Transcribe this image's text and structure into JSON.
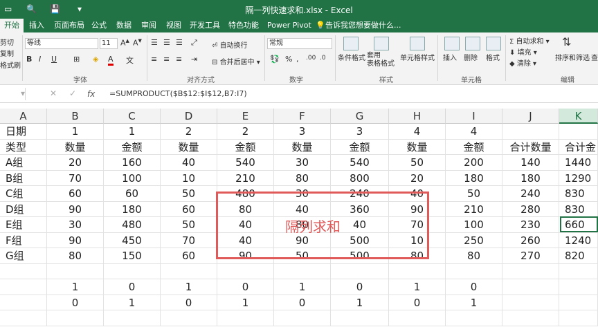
{
  "window": {
    "title": "隔一列快速求和.xlsx - Excel",
    "quick_access": [
      "save-icon",
      "undo-icon",
      "customize-icon"
    ]
  },
  "tabs": [
    "开始",
    "插入",
    "页面布局",
    "公式",
    "数据",
    "审阅",
    "视图",
    "开发工具",
    "特色功能",
    "Power Pivot"
  ],
  "tell_me": "告诉我您想要做什么...",
  "ribbon": {
    "clipboard": {
      "cut": "剪切",
      "copy": "复制",
      "format_painter": "格式刷"
    },
    "font": {
      "name": "等线",
      "size": "11",
      "bold": "B",
      "italic": "I",
      "underline": "U",
      "group": "字体"
    },
    "alignment": {
      "wrap": "自动换行",
      "merge": "合并后居中",
      "group": "对齐方式"
    },
    "number": {
      "format": "常规",
      "group": "数字"
    },
    "styles": {
      "conditional": "条件格式",
      "table": "套用\n表格格式",
      "cell": "单元格样式",
      "group": "样式"
    },
    "cells": {
      "insert": "插入",
      "delete": "删除",
      "format": "格式",
      "group": "单元格"
    },
    "editing": {
      "autosum": "自动求和",
      "fill": "填充",
      "clear": "清除",
      "sort": "排序和筛选",
      "find": "查",
      "group": "编辑"
    }
  },
  "formula_bar": {
    "fx": "fx",
    "formula": "=SUMPRODUCT($B$12:$I$12,B7:I7)"
  },
  "columns": [
    "A",
    "B",
    "C",
    "D",
    "E",
    "F",
    "G",
    "H",
    "I",
    "J",
    "K"
  ],
  "rows": [
    [
      "日期",
      "1",
      "1",
      "2",
      "2",
      "3",
      "3",
      "4",
      "4",
      "",
      ""
    ],
    [
      "类型",
      "数量",
      "金额",
      "数量",
      "金额",
      "数量",
      "金额",
      "数量",
      "金额",
      "合计数量",
      "合计金"
    ],
    [
      "A组",
      "20",
      "160",
      "40",
      "540",
      "30",
      "540",
      "50",
      "200",
      "140",
      "1440"
    ],
    [
      "B组",
      "70",
      "100",
      "10",
      "210",
      "80",
      "800",
      "20",
      "180",
      "180",
      "1290"
    ],
    [
      "C组",
      "60",
      "60",
      "50",
      "480",
      "30",
      "240",
      "40",
      "50",
      "240",
      "830"
    ],
    [
      "D组",
      "90",
      "180",
      "60",
      "80",
      "40",
      "360",
      "90",
      "210",
      "280",
      "830"
    ],
    [
      "E组",
      "30",
      "480",
      "50",
      "40",
      "80",
      "40",
      "70",
      "100",
      "230",
      "660"
    ],
    [
      "F组",
      "90",
      "450",
      "70",
      "40",
      "90",
      "500",
      "10",
      "250",
      "260",
      "1240"
    ],
    [
      "G组",
      "80",
      "150",
      "60",
      "90",
      "50",
      "500",
      "80",
      "80",
      "270",
      "820"
    ],
    [
      "",
      "",
      "",
      "",
      "",
      "",
      "",
      "",
      "",
      "",
      ""
    ],
    [
      "",
      "1",
      "0",
      "1",
      "0",
      "1",
      "0",
      "1",
      "0",
      "",
      ""
    ],
    [
      "",
      "0",
      "1",
      "0",
      "1",
      "0",
      "1",
      "0",
      "1",
      "",
      ""
    ],
    [
      "",
      "",
      "",
      "",
      "",
      "",
      "",
      "",
      "",
      "",
      ""
    ]
  ],
  "annotation": {
    "text": "隔列求和",
    "color": "#e05a5a"
  },
  "colors": {
    "excel_green": "#217346",
    "annotation_red": "#e05a5a"
  }
}
